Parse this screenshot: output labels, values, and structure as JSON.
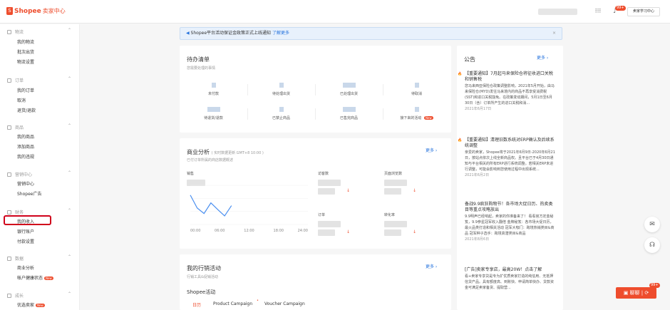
{
  "topbar": {
    "brand": "Shopee",
    "brand_sub": "卖家中心",
    "notif_badge": "99+",
    "learn_btn": "卖家学习中心"
  },
  "sidebar": {
    "sections": [
      {
        "title": "物流",
        "items": [
          "我的物流",
          "批次出货",
          "物流设置"
        ]
      },
      {
        "title": "订单",
        "items": [
          "我的订单",
          "取消",
          "退货/退款"
        ]
      },
      {
        "title": "商品",
        "items": [
          "我的商品",
          "添加商品",
          "我的违规"
        ]
      },
      {
        "title": "营销中心",
        "items": [
          "营销中心",
          "Shopee广告"
        ]
      },
      {
        "title": "财务",
        "items": [
          "我的收入",
          "银行账户",
          "付款设置"
        ]
      },
      {
        "title": "数据",
        "items": [
          "商业分析",
          "帐户健康状态"
        ]
      },
      {
        "title": "成长",
        "items": [
          "优选卖家"
        ]
      }
    ],
    "new_tag": "New"
  },
  "notice": {
    "text": "Shopee平台活动保证金政策正式上线通知",
    "link": "了解更多"
  },
  "todo": {
    "title": "待办清单",
    "subtitle": "您需要处理的事情",
    "cells": [
      "未付款",
      "待处理出货",
      "已处理出货",
      "待取消",
      "待退货/退款",
      "已禁止商品",
      "已售完商品",
      "接下来的活动"
    ]
  },
  "analysis": {
    "title": "商业分析",
    "note": "( 实时数据更新 GMT+8 10:00 )",
    "subtitle": "已付订单所属的商店数据概述",
    "more": "更多",
    "sales_label": "销售",
    "chart_data": {
      "type": "line",
      "x_ticks": [
        "00:00",
        "06:00",
        "12:00",
        "18:00",
        "24:00"
      ],
      "x": [
        0,
        1,
        2,
        3,
        4,
        5,
        6
      ],
      "values": [
        0.75,
        0.42,
        0.28,
        0.55,
        0.38,
        0.22,
        0.48
      ]
    },
    "metrics": [
      "访客数",
      "页面浏览数",
      "订单",
      "转化率"
    ]
  },
  "marketing": {
    "title": "我的行销活动",
    "subtitle": "行销工具&促销活动",
    "more": "更多",
    "section": "Shopee活动",
    "tabs": [
      "日历",
      "Product Campaign",
      "Voucher Campaign"
    ]
  },
  "announcement": {
    "title": "公告",
    "more": "更多",
    "items": [
      {
        "title": "【重要通知】7月起马来保险仓将征收进口关税和销售税",
        "body": "您马来西亚保险仓政策调整影响，2021年5月开始，由马来保险仓(MYD)发往马来境内的商品不再享受消费税(SST)和进口关税豁免。在政策变动期间，5月1日至6月30日（含）订单所产生的进口关税和消...",
        "date": "2021年6月17日"
      },
      {
        "title": "【重要通知】清理旧数系统对ERP确认及后续系统调整",
        "body": "亲爱的卖家，Shopee将于2021年6月9日-2020年6月21日，按站点依次上线全新商品权。且平台已于4月30日通知与平台相关的所有ERP进行系统调整。若相关ERP未进行调整，可能会影响到您使用过程中出现系统...",
        "date": "2021年6月2日"
      },
      {
        "title": "备战9.9疯狂购物节！各市场大促日历、热卖类目等重点攻略放出",
        "body": "9.9明声已经响起，卖家的你准备来了！ 看看官方定金秘笈，9.9参星冠军收入翻倍 金牌秘笈：各市场大促日历，最火品类打造和相关活动 冠军大咖门：跨境热销类目&商品 冠军种子选手：跨境高潜类目&商品",
        "date": "2021年8月6日"
      },
      {
        "title": "[广告]卖家专享店，最高20W！点击了解",
        "body": "看+卖家专享贷是专为扩优质卖家打造的纯信用、无抵押信贷产品。具有额度高、到账快、申请简单快办、贷款资金可满足卖家备货、提取营..."
      }
    ]
  },
  "widgets": {
    "badge": "99+",
    "chat": "聊聊"
  }
}
